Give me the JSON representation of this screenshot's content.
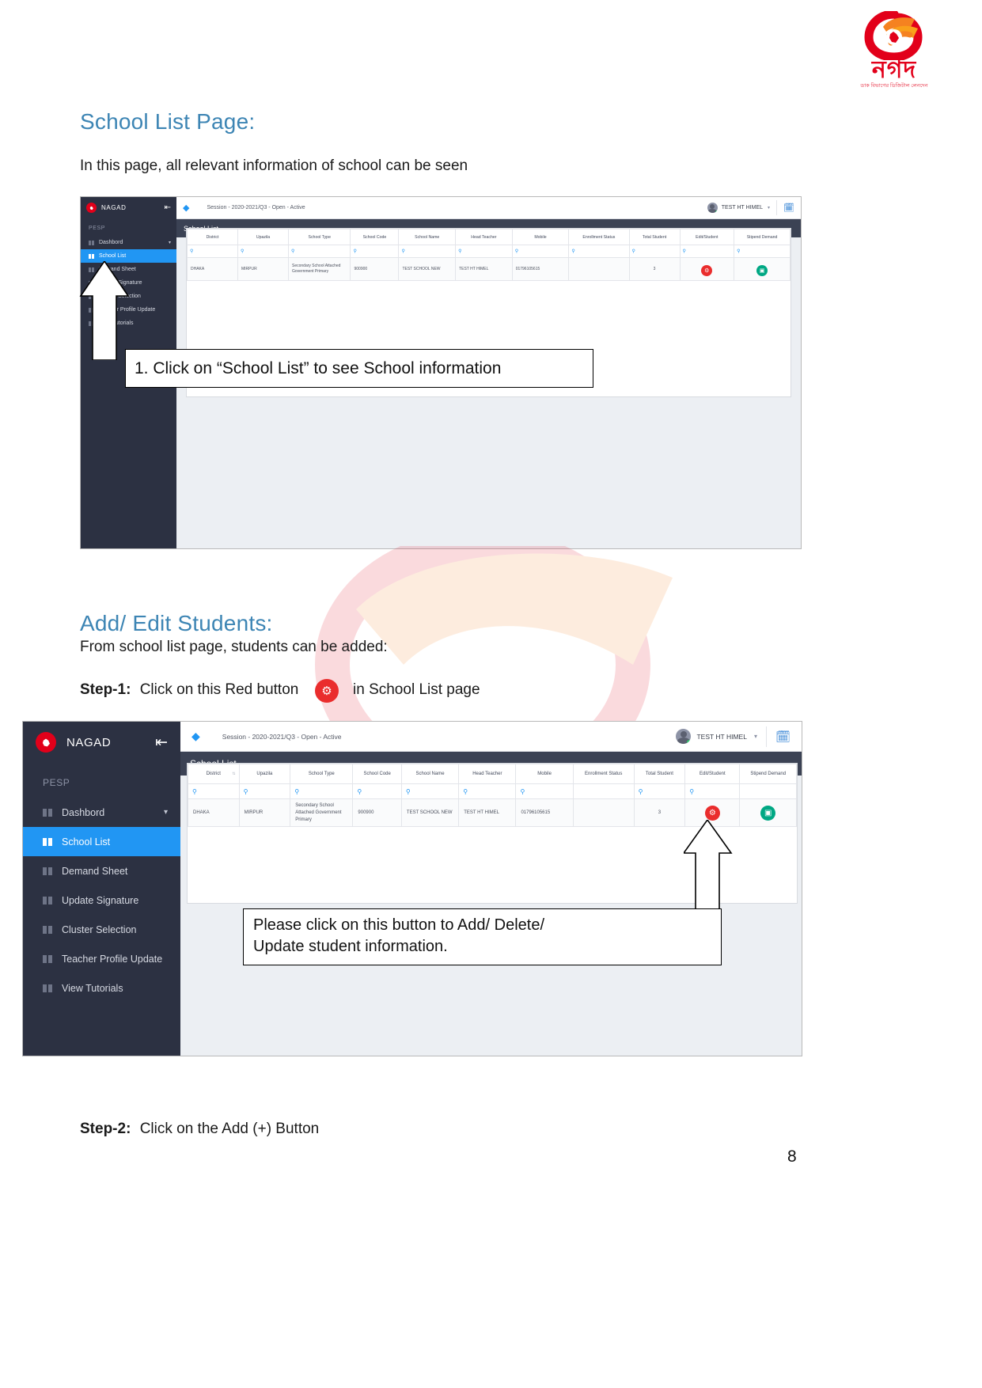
{
  "brand": {
    "logo_word": "নগদ",
    "logo_tagline": "ডাক বিভাগের ডিজিটাল লেনদেন",
    "app_name": "NAGAD"
  },
  "document": {
    "heading_1": "School List Page:",
    "para_1": "In this page, all relevant information of school can be seen",
    "heading_2": "Add/ Edit Students:",
    "para_2": "From school list page, students can be added:",
    "step_1_label": "Step-1:",
    "step_1_text": "Click on this Red button",
    "step_1_text_tail": "in School List page",
    "step_2_label": "Step-2:",
    "step_2_text": "Click on the Add (+) Button",
    "page_number": "8",
    "heading_color": "#3d85b4"
  },
  "callouts": {
    "first": "1. Click on “School List” to see School information",
    "second_line_1": "Please click on this button to Add/ Delete/",
    "second_line_2": "Update student information."
  },
  "app": {
    "topbar": {
      "layers_icon": "layers-icon",
      "session": "Session - 2020-2021/Q3 - Open - Active",
      "user_name": "TEST HT HIMEL",
      "caret_icon": "chevron-down-icon",
      "calendar_icon": "calendar-icon"
    },
    "sidebar": {
      "collapse_icon": "collapse-arrow-icon",
      "section_label": "PESP",
      "items": [
        {
          "label": "Dashbord",
          "icon": "grid-icon",
          "active": false,
          "has_chevron": true
        },
        {
          "label": "School List",
          "icon": "grid-icon",
          "active": true,
          "has_chevron": false
        },
        {
          "label": "Demand Sheet",
          "icon": "grid-icon",
          "active": false,
          "has_chevron": false
        },
        {
          "label": "Update Signature",
          "icon": "grid-icon",
          "active": false,
          "has_chevron": false
        },
        {
          "label": "Cluster Selection",
          "icon": "grid-icon",
          "active": false,
          "has_chevron": false
        },
        {
          "label": "Teacher Profile Update",
          "icon": "grid-icon",
          "active": false,
          "has_chevron": false
        },
        {
          "label": "View Tutorials",
          "icon": "grid-icon",
          "active": false,
          "has_chevron": false
        }
      ]
    },
    "page_title": "School List",
    "table": {
      "columns": [
        "District",
        "Upazila",
        "School Type",
        "School Code",
        "School Name",
        "Head Teacher",
        "Mobile",
        "Enrollment Status",
        "Total Student",
        "Edit/Student",
        "Stipend Demand"
      ],
      "filter_icon": "search-icon",
      "rows": [
        {
          "district": "DHAKA",
          "upazila": "MIRPUR",
          "school_type": "Secondary School Attached Government Primary",
          "school_code": "900900",
          "school_name": "TEST SCHOOL NEW",
          "head_teacher": "TEST HT HIMEL",
          "mobile": "01796105615",
          "enrollment_status": "",
          "total_student": "3",
          "edit_student_icon": "edit-student-icon",
          "stipend_demand_icon": "stipend-demand-icon"
        }
      ]
    },
    "colors": {
      "sidebar_bg": "#2c3142",
      "active_nav": "#2196f3",
      "title_bar": "#3b4254",
      "red_button": "#ea2d2d",
      "green_button": "#00a884"
    }
  }
}
